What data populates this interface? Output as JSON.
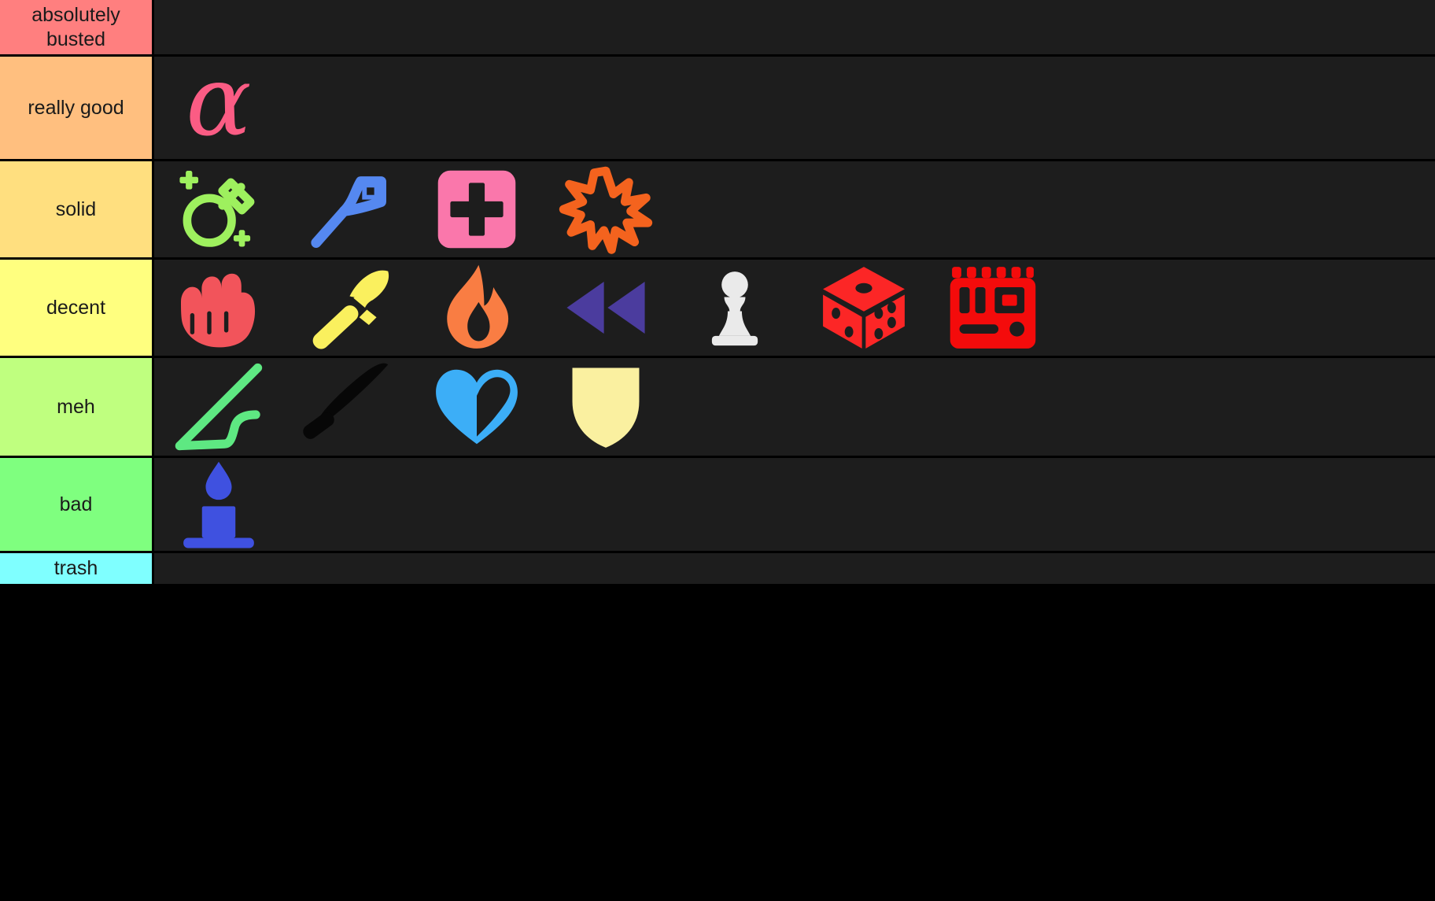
{
  "tierlist": {
    "background_color": "#1d1d1d",
    "divider_color": "#000000",
    "label_text_color": "#1a1a1a",
    "rows": [
      {
        "label": "absolutely busted",
        "color": "#FF7F7F",
        "items": []
      },
      {
        "label": "really good",
        "color": "#FFBF7F",
        "items": [
          {
            "icon": "alpha-symbol-icon",
            "color": "#FB5C84"
          }
        ]
      },
      {
        "label": "solid",
        "color": "#FFDF7F",
        "items": [
          {
            "icon": "potion-flask-icon",
            "color": "#9EF05E"
          },
          {
            "icon": "key-icon",
            "color": "#5588F0"
          },
          {
            "icon": "medkit-plus-icon",
            "color": "#FA77AB"
          },
          {
            "icon": "explosion-burst-icon",
            "color": "#F4631E"
          }
        ]
      },
      {
        "label": "decent",
        "color": "#FFFF7F",
        "items": [
          {
            "icon": "fist-punch-icon",
            "color": "#F2545B"
          },
          {
            "icon": "hammer-icon",
            "color": "#FAF05E"
          },
          {
            "icon": "flame-fire-icon",
            "color": "#F97D43"
          },
          {
            "icon": "rewind-double-arrow-icon",
            "color": "#4B3C9E"
          },
          {
            "icon": "chess-pawn-icon",
            "color": "#EAEAEA"
          },
          {
            "icon": "dice-icon",
            "color": "#FC2626"
          },
          {
            "icon": "detonator-box-icon",
            "color": "#F40B0B"
          }
        ]
      },
      {
        "label": "meh",
        "color": "#BFFF7F",
        "items": [
          {
            "icon": "bow-icon",
            "color": "#5EE882"
          },
          {
            "icon": "knife-dagger-icon",
            "color": "#070707"
          },
          {
            "icon": "heart-outline-icon",
            "color": "#3CAEF7"
          },
          {
            "icon": "shield-icon",
            "color": "#FAF0A0"
          }
        ]
      },
      {
        "label": "bad",
        "color": "#7FFF7F",
        "items": [
          {
            "icon": "candle-icon",
            "color": "#3F51E0"
          }
        ]
      },
      {
        "label": "trash",
        "color": "#7FFFFF",
        "items": []
      }
    ]
  }
}
